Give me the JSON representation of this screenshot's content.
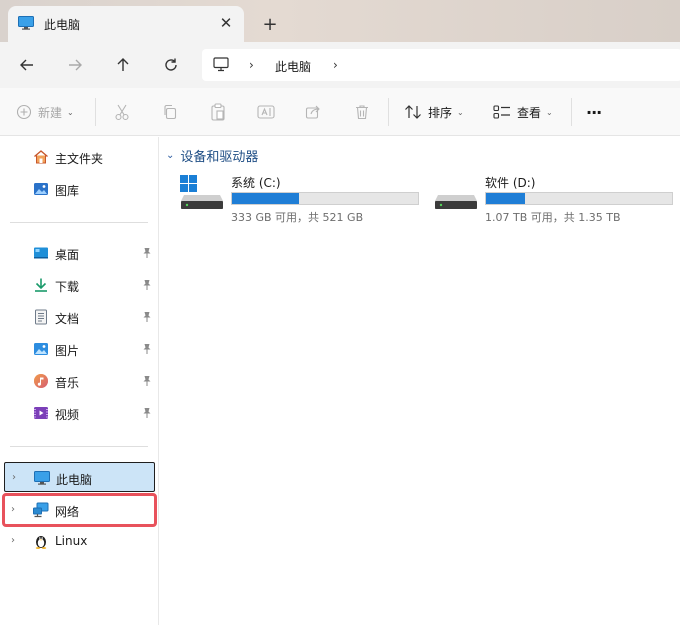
{
  "tab": {
    "title": "此电脑",
    "close": "✕",
    "new_tab": "+"
  },
  "address": {
    "sep1": "›",
    "crumb": "此电脑",
    "sep2": "›"
  },
  "toolbar": {
    "new_label": "新建",
    "sort_label": "排序",
    "view_label": "查看",
    "more": "···",
    "caret": "⌄"
  },
  "sidebar": {
    "quick": [
      {
        "label": "主文件夹"
      },
      {
        "label": "图库"
      }
    ],
    "pinned": [
      {
        "label": "桌面"
      },
      {
        "label": "下载"
      },
      {
        "label": "文档"
      },
      {
        "label": "图片"
      },
      {
        "label": "音乐"
      },
      {
        "label": "视频"
      }
    ],
    "tree": [
      {
        "label": "此电脑"
      },
      {
        "label": "网络"
      },
      {
        "label": "Linux"
      }
    ],
    "chevron": "›"
  },
  "main": {
    "group_title": "设备和驱动器",
    "group_chevron": "⌄",
    "drives": [
      {
        "name": "系统 (C:)",
        "info": "333 GB 可用，共 521 GB",
        "used_fraction": 0.361
      },
      {
        "name": "软件 (D:)",
        "info": "1.07 TB 可用，共 1.35 TB",
        "used_fraction": 0.207
      }
    ]
  },
  "colors": {
    "accent": "#1f7ed6",
    "selected_bg": "#cce4f7",
    "highlight_border": "#e8525c"
  }
}
